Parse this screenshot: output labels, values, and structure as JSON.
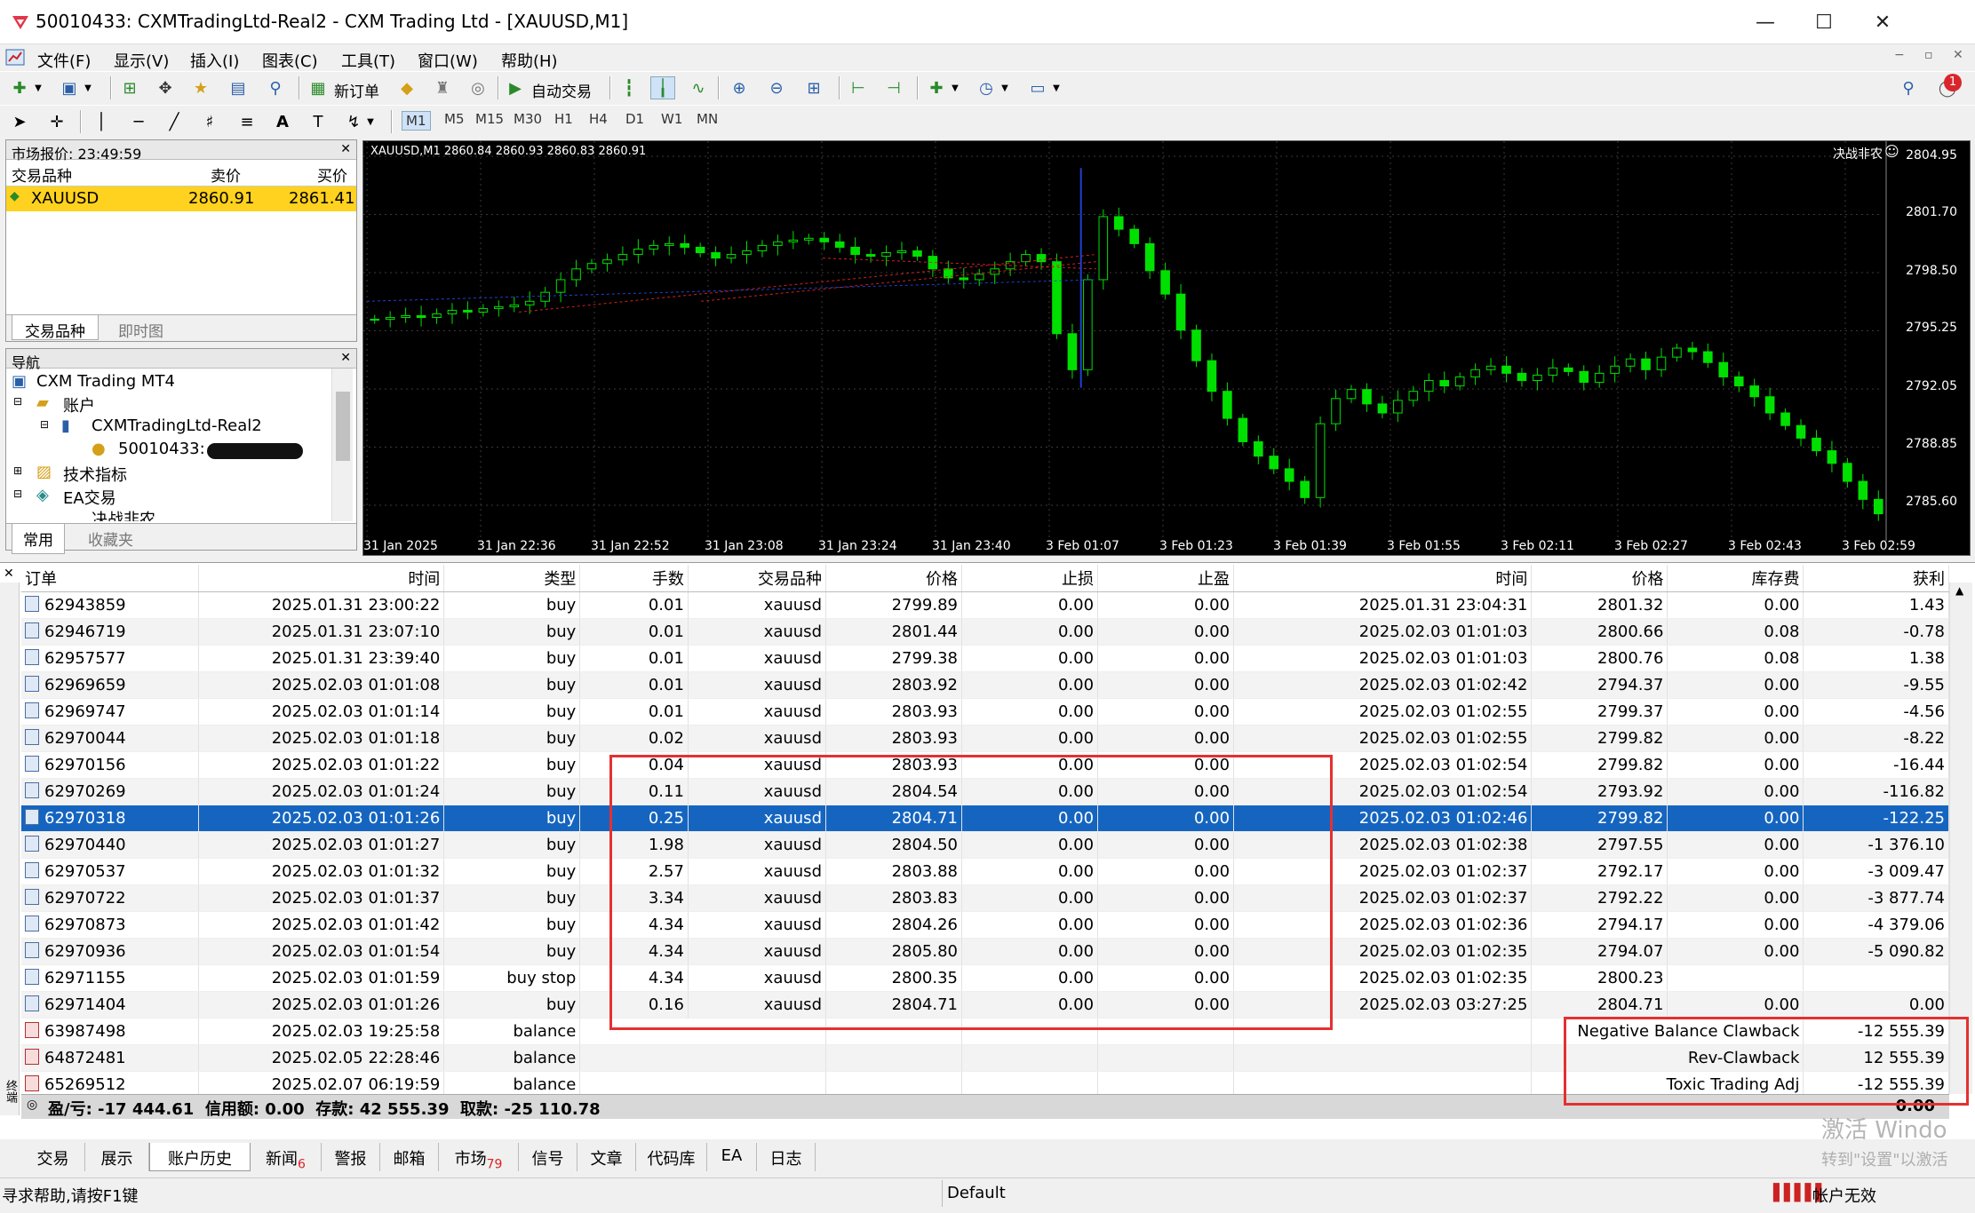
{
  "title_bar": {
    "title": "50010433: CXMTradingLtd-Real2 - CXM Trading Ltd - [XAUUSD,M1]"
  },
  "menu": [
    "文件(F)",
    "显示(V)",
    "插入(I)",
    "图表(C)",
    "工具(T)",
    "窗口(W)",
    "帮助(H)"
  ],
  "toolbar": {
    "new_order": "新订单",
    "auto_trade": "自动交易",
    "notif_count": "1"
  },
  "timeframes": [
    "M1",
    "M5",
    "M15",
    "M30",
    "H1",
    "H4",
    "D1",
    "W1",
    "MN"
  ],
  "market_watch": {
    "header": "市场报价: 23:49:59",
    "col_symbol": "交易品种",
    "col_bid": "卖价",
    "col_ask": "买价",
    "rows": [
      {
        "symbol": "XAUUSD",
        "bid": "2860.91",
        "ask": "2861.41"
      }
    ],
    "tabs": [
      "交易品种",
      "即时图"
    ]
  },
  "navigator": {
    "header": "导航",
    "items": [
      "CXM Trading MT4",
      "账户",
      "CXMTradingLtd-Real2",
      "50010433:",
      "技术指标",
      "EA交易",
      "决战非农"
    ],
    "tabs": [
      "常用",
      "收藏夹"
    ]
  },
  "chart": {
    "info": "XAUUSD,M1  2860.84 2860.93 2860.83 2860.91",
    "ea_name": "决战非农",
    "y_labels": [
      "2804.95",
      "2801.70",
      "2798.50",
      "2795.25",
      "2792.05",
      "2788.85",
      "2785.60"
    ],
    "x_labels": [
      "31 Jan 2025",
      "31 Jan 22:36",
      "31 Jan 22:52",
      "31 Jan 23:08",
      "31 Jan 23:24",
      "31 Jan 23:40",
      "3 Feb 01:07",
      "3 Feb 01:23",
      "3 Feb 01:39",
      "3 Feb 01:55",
      "3 Feb 02:11",
      "3 Feb 02:27",
      "3 Feb 02:43",
      "3 Feb 02:59"
    ]
  },
  "chart_data": {
    "type": "candlestick",
    "symbol": "XAUUSD",
    "timeframe": "M1",
    "ylim": [
      2784.5,
      2806.0
    ],
    "closes": [
      2796.8,
      2796.9,
      2797.0,
      2796.9,
      2797.1,
      2797.3,
      2797.2,
      2797.4,
      2797.5,
      2797.6,
      2797.8,
      2798.3,
      2799.0,
      2799.6,
      2799.9,
      2800.1,
      2800.4,
      2800.7,
      2800.9,
      2801.0,
      2800.8,
      2800.5,
      2800.2,
      2800.4,
      2800.6,
      2800.9,
      2801.1,
      2801.2,
      2801.3,
      2801.1,
      2800.8,
      2800.4,
      2800.3,
      2800.5,
      2800.6,
      2800.3,
      2799.6,
      2799.1,
      2799.0,
      2799.3,
      2799.6,
      2800.0,
      2800.4,
      2800.0,
      2796.0,
      2794.0,
      2799.0,
      2802.5,
      2801.8,
      2801.0,
      2799.5,
      2798.2,
      2796.2,
      2794.5,
      2792.8,
      2791.3,
      2790.0,
      2789.2,
      2788.5,
      2787.8,
      2786.9,
      2791.0,
      2792.4,
      2792.9,
      2792.1,
      2791.6,
      2792.3,
      2792.8,
      2793.4,
      2793.1,
      2793.6,
      2794.0,
      2794.2,
      2793.8,
      2793.4,
      2793.7,
      2794.1,
      2793.9,
      2793.3,
      2793.8,
      2794.2,
      2794.6,
      2794.0,
      2794.7,
      2795.2,
      2795.0,
      2794.4,
      2793.6,
      2793.1,
      2792.5,
      2791.6,
      2790.9,
      2790.2,
      2789.5,
      2788.8,
      2787.8,
      2786.8,
      2786.0
    ]
  },
  "terminal": {
    "columns": [
      "订单",
      "时间",
      "类型",
      "手数",
      "交易品种",
      "价格",
      "止损",
      "止盈",
      "时间",
      "价格",
      "库存费",
      "获利"
    ],
    "rows": [
      {
        "order": "62943859",
        "open": "2025.01.31 23:00:22",
        "type": "buy",
        "lots": "0.01",
        "sym": "xauusd",
        "price": "2799.89",
        "sl": "0.00",
        "tp": "0.00",
        "close": "2025.01.31 23:04:31",
        "cprice": "2801.32",
        "swap": "0.00",
        "profit": "1.43"
      },
      {
        "order": "62946719",
        "open": "2025.01.31 23:07:10",
        "type": "buy",
        "lots": "0.01",
        "sym": "xauusd",
        "price": "2801.44",
        "sl": "0.00",
        "tp": "0.00",
        "close": "2025.02.03 01:01:03",
        "cprice": "2800.66",
        "swap": "0.08",
        "profit": "-0.78"
      },
      {
        "order": "62957577",
        "open": "2025.01.31 23:39:40",
        "type": "buy",
        "lots": "0.01",
        "sym": "xauusd",
        "price": "2799.38",
        "sl": "0.00",
        "tp": "0.00",
        "close": "2025.02.03 01:01:03",
        "cprice": "2800.76",
        "swap": "0.08",
        "profit": "1.38"
      },
      {
        "order": "62969659",
        "open": "2025.02.03 01:01:08",
        "type": "buy",
        "lots": "0.01",
        "sym": "xauusd",
        "price": "2803.92",
        "sl": "0.00",
        "tp": "0.00",
        "close": "2025.02.03 01:02:42",
        "cprice": "2794.37",
        "swap": "0.00",
        "profit": "-9.55"
      },
      {
        "order": "62969747",
        "open": "2025.02.03 01:01:14",
        "type": "buy",
        "lots": "0.01",
        "sym": "xauusd",
        "price": "2803.93",
        "sl": "0.00",
        "tp": "0.00",
        "close": "2025.02.03 01:02:55",
        "cprice": "2799.37",
        "swap": "0.00",
        "profit": "-4.56"
      },
      {
        "order": "62970044",
        "open": "2025.02.03 01:01:18",
        "type": "buy",
        "lots": "0.02",
        "sym": "xauusd",
        "price": "2803.93",
        "sl": "0.00",
        "tp": "0.00",
        "close": "2025.02.03 01:02:55",
        "cprice": "2799.82",
        "swap": "0.00",
        "profit": "-8.22"
      },
      {
        "order": "62970156",
        "open": "2025.02.03 01:01:22",
        "type": "buy",
        "lots": "0.04",
        "sym": "xauusd",
        "price": "2803.93",
        "sl": "0.00",
        "tp": "0.00",
        "close": "2025.02.03 01:02:54",
        "cprice": "2799.82",
        "swap": "0.00",
        "profit": "-16.44"
      },
      {
        "order": "62970269",
        "open": "2025.02.03 01:01:24",
        "type": "buy",
        "lots": "0.11",
        "sym": "xauusd",
        "price": "2804.54",
        "sl": "0.00",
        "tp": "0.00",
        "close": "2025.02.03 01:02:54",
        "cprice": "2793.92",
        "swap": "0.00",
        "profit": "-116.82"
      },
      {
        "order": "62970318",
        "open": "2025.02.03 01:01:26",
        "type": "buy",
        "lots": "0.25",
        "sym": "xauusd",
        "price": "2804.71",
        "sl": "0.00",
        "tp": "0.00",
        "close": "2025.02.03 01:02:46",
        "cprice": "2799.82",
        "swap": "0.00",
        "profit": "-122.25"
      },
      {
        "order": "62970440",
        "open": "2025.02.03 01:01:27",
        "type": "buy",
        "lots": "1.98",
        "sym": "xauusd",
        "price": "2804.50",
        "sl": "0.00",
        "tp": "0.00",
        "close": "2025.02.03 01:02:38",
        "cprice": "2797.55",
        "swap": "0.00",
        "profit": "-1 376.10"
      },
      {
        "order": "62970537",
        "open": "2025.02.03 01:01:32",
        "type": "buy",
        "lots": "2.57",
        "sym": "xauusd",
        "price": "2803.88",
        "sl": "0.00",
        "tp": "0.00",
        "close": "2025.02.03 01:02:37",
        "cprice": "2792.17",
        "swap": "0.00",
        "profit": "-3 009.47"
      },
      {
        "order": "62970722",
        "open": "2025.02.03 01:01:37",
        "type": "buy",
        "lots": "3.34",
        "sym": "xauusd",
        "price": "2803.83",
        "sl": "0.00",
        "tp": "0.00",
        "close": "2025.02.03 01:02:37",
        "cprice": "2792.22",
        "swap": "0.00",
        "profit": "-3 877.74"
      },
      {
        "order": "62970873",
        "open": "2025.02.03 01:01:42",
        "type": "buy",
        "lots": "4.34",
        "sym": "xauusd",
        "price": "2804.26",
        "sl": "0.00",
        "tp": "0.00",
        "close": "2025.02.03 01:02:36",
        "cprice": "2794.17",
        "swap": "0.00",
        "profit": "-4 379.06"
      },
      {
        "order": "62970936",
        "open": "2025.02.03 01:01:54",
        "type": "buy",
        "lots": "4.34",
        "sym": "xauusd",
        "price": "2805.80",
        "sl": "0.00",
        "tp": "0.00",
        "close": "2025.02.03 01:02:35",
        "cprice": "2794.07",
        "swap": "0.00",
        "profit": "-5 090.82"
      },
      {
        "order": "62971155",
        "open": "2025.02.03 01:01:59",
        "type": "buy stop",
        "lots": "4.34",
        "sym": "xauusd",
        "price": "2800.35",
        "sl": "0.00",
        "tp": "0.00",
        "close": "2025.02.03 01:02:35",
        "cprice": "2800.23",
        "swap": "",
        "profit": ""
      },
      {
        "order": "62971404",
        "open": "2025.02.03 01:01:26",
        "type": "buy",
        "lots": "0.16",
        "sym": "xauusd",
        "price": "2804.71",
        "sl": "0.00",
        "tp": "0.00",
        "close": "2025.02.03 03:27:25",
        "cprice": "2804.71",
        "swap": "0.00",
        "profit": "0.00"
      }
    ],
    "balance_rows": [
      {
        "order": "63987498",
        "open": "2025.02.03 19:25:58",
        "type": "balance",
        "comment": "Negative Balance Clawback",
        "profit": "-12 555.39"
      },
      {
        "order": "64872481",
        "open": "2025.02.05 22:28:46",
        "type": "balance",
        "comment": "Rev-Clawback",
        "profit": "12 555.39"
      },
      {
        "order": "65269512",
        "open": "2025.02.07 06:19:59",
        "type": "balance",
        "comment": "Toxic Trading Adj",
        "profit": "-12 555.39"
      }
    ],
    "total_text": "盈/亏: -17 444.61  信用额: 0.00  存款: 42 555.39  取款: -25 110.78",
    "total_profit": "0.00",
    "tabs": [
      "交易",
      "展示",
      "账户历史",
      "新闻",
      "警报",
      "邮箱",
      "市场",
      "信号",
      "文章",
      "代码库",
      "EA",
      "日志"
    ],
    "news_count": "6",
    "market_count": "79",
    "side_label": "终端"
  },
  "watermark": {
    "line1": "激活 Windo",
    "line2": "转到\"设置\"以激活"
  },
  "status_bar": {
    "help": "寻求帮助,请按F1键",
    "profile": "Default",
    "account": "帐户无效"
  }
}
